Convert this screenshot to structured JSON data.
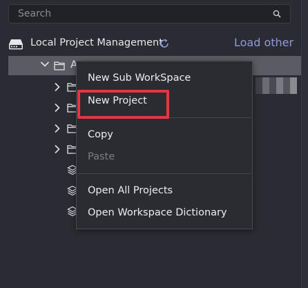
{
  "search": {
    "placeholder": "Search",
    "value": ""
  },
  "header": {
    "title": "Local Project Management",
    "load_other": "Load other"
  },
  "tree": {
    "root_label": "A",
    "children": [
      {
        "type": "folder"
      },
      {
        "type": "folder"
      },
      {
        "type": "folder"
      },
      {
        "type": "folder"
      },
      {
        "type": "project"
      },
      {
        "type": "project"
      },
      {
        "type": "project"
      }
    ]
  },
  "context_menu": {
    "items": [
      {
        "label": "New Sub WorkSpace",
        "enabled": true
      },
      {
        "label": "New Project",
        "enabled": true,
        "highlighted": true
      },
      {
        "label": "Copy",
        "enabled": true
      },
      {
        "label": "Paste",
        "enabled": false
      },
      {
        "label": "Open All Projects",
        "enabled": true
      },
      {
        "label": "Open Workspace Dictionary",
        "enabled": true
      }
    ]
  },
  "colors": {
    "background": "#2b2c33",
    "accent_link": "#8f9bd8",
    "highlight_border": "#e43643",
    "selected_row": "#5b5c63"
  }
}
